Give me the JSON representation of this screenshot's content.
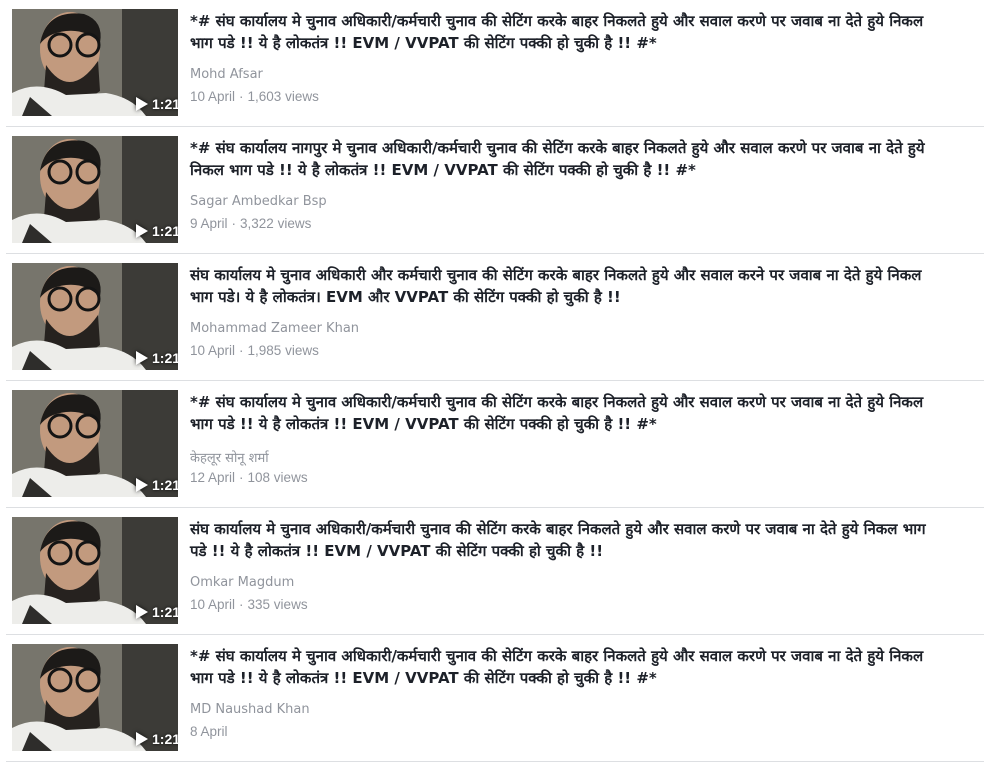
{
  "videos": [
    {
      "title": "*# संघ कार्यालय मे चुनाव अधिकारी/कर्मचारी चुनाव की सेटिंग करके बाहर निकलते हुये और सवाल करणे पर जवाब ना देते हुये निकल भाग पडे !! ये है लोकतंत्र !! EVM / VVPAT की सेटिंग पक्की हो चुकी है !! #*",
      "author": "Mohd Afsar",
      "date": "10 April",
      "separator": "·",
      "views": "1,603 views",
      "duration": "1:21"
    },
    {
      "title": "*# संघ कार्यालय नागपुर मे चुनाव अधिकारी/कर्मचारी चुनाव की सेटिंग करके बाहर निकलते हुये और सवाल करणे पर जवाब ना देते हुये निकल भाग पडे !! ये है लोकतंत्र !! EVM / VVPAT की सेटिंग पक्की हो चुकी है !! #*",
      "author": "Sagar Ambedkar Bsp",
      "date": "9 April",
      "separator": "·",
      "views": "3,322 views",
      "duration": "1:21"
    },
    {
      "title": "संघ कार्यालय मे चुनाव अधिकारी और कर्मचारी चुनाव की सेटिंग करके बाहर निकलते हुये और सवाल करने पर जवाब ना देते हुये निकल भाग पडे। ये है लोकतंत्र। EVM और VVPAT की सेटिंग पक्की हो चुकी है !!",
      "author": "Mohammad Zameer Khan",
      "date": "10 April",
      "separator": "·",
      "views": "1,985 views",
      "duration": "1:21"
    },
    {
      "title": "*# संघ कार्यालय मे चुनाव अधिकारी/कर्मचारी चुनाव की सेटिंग करके बाहर निकलते हुये और सवाल करणे पर जवाब ना देते हुये निकल भाग पडे !! ये है लोकतंत्र !! EVM / VVPAT की सेटिंग पक्की हो चुकी है !! #*",
      "author": "केहलूर सोनू शर्मा",
      "date": "12 April",
      "separator": "·",
      "views": "108 views",
      "duration": "1:21"
    },
    {
      "title": "संघ कार्यालय मे चुनाव अधिकारी/कर्मचारी चुनाव की सेटिंग करके बाहर निकलते हुये और सवाल करणे पर जवाब ना देते हुये निकल भाग पडे !! ये है लोकतंत्र !! EVM / VVPAT की सेटिंग पक्की हो चुकी है !!",
      "author": "Omkar Magdum",
      "date": "10 April",
      "separator": "·",
      "views": "335 views",
      "duration": "1:21"
    },
    {
      "title": "*# संघ कार्यालय मे चुनाव अधिकारी/कर्मचारी चुनाव की सेटिंग करके बाहर निकलते हुये और सवाल करणे पर जवाब ना देते हुये निकल भाग पडे !! ये है लोकतंत्र !! EVM / VVPAT की सेटिंग पक्की हो चुकी है !! #*",
      "author": "MD Naushad Khan",
      "date": "8 April",
      "separator": "",
      "views": "",
      "duration": "1:21"
    }
  ],
  "icons": {
    "play": "play-icon"
  }
}
